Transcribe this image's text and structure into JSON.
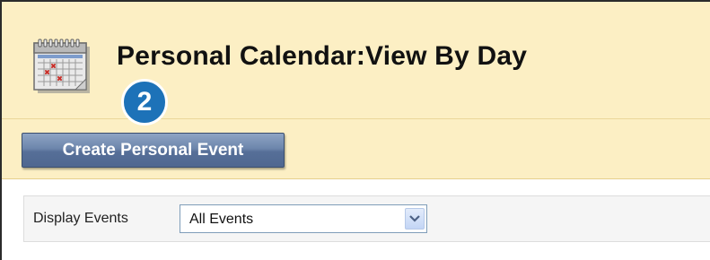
{
  "page": {
    "title": "Personal Calendar:View By Day",
    "step_number": "2"
  },
  "actions": {
    "create_event_label": "Create Personal Event"
  },
  "filter": {
    "label": "Display Events",
    "selected_value": "All Events"
  },
  "colors": {
    "header_background": "#fcefc4",
    "button_blue": "#5d76a0",
    "step_badge": "#1d72b8"
  },
  "icons": {
    "page_icon": "calendar-icon",
    "dropdown_icon": "chevron-down-icon"
  }
}
